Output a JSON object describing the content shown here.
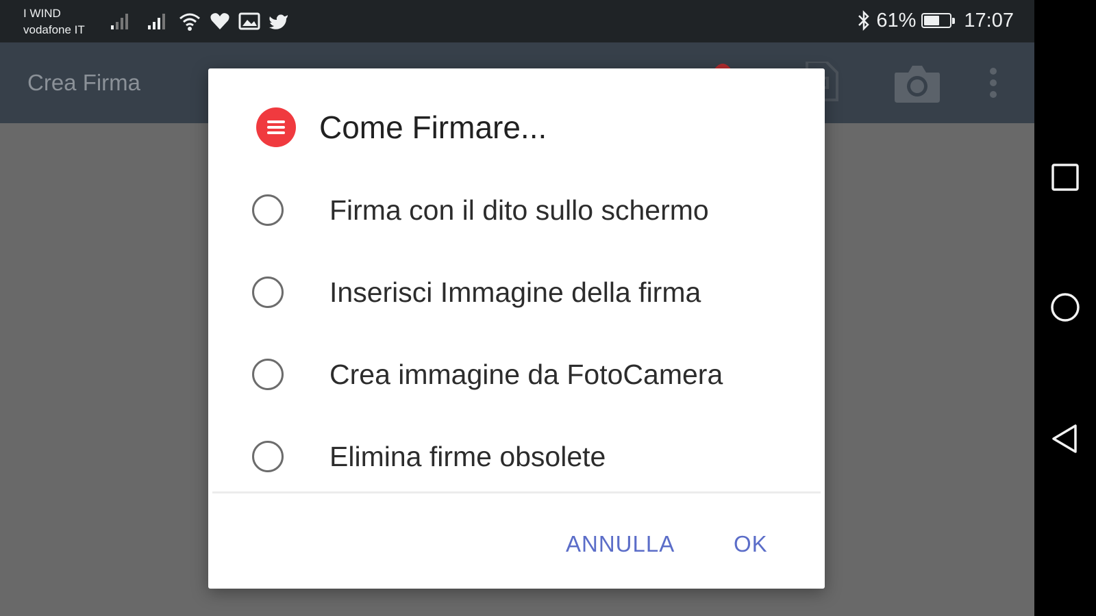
{
  "status_bar": {
    "carrier_line1": "I WIND",
    "carrier_line2": "vodafone IT",
    "battery_percent": "61%",
    "battery_level": 0.61,
    "time": "17:07",
    "icons": [
      "signal-weak-icon",
      "signal-icon",
      "wifi-icon",
      "heart-icon",
      "image-notification-icon",
      "twitter-icon",
      "bluetooth-icon",
      "battery-icon"
    ]
  },
  "app_bar": {
    "title": "Crea Firma",
    "actions": [
      "record-icon",
      "document-icon",
      "camera-icon",
      "more-vert-icon"
    ]
  },
  "dialog": {
    "icon": "menu-circle-icon",
    "icon_color": "#f03a3f",
    "title": "Come Firmare...",
    "options": [
      {
        "label": "Firma con il dito sullo schermo",
        "selected": false
      },
      {
        "label": "Inserisci Immagine della firma",
        "selected": false
      },
      {
        "label": "Crea immagine da FotoCamera",
        "selected": false
      },
      {
        "label": "Elimina firme obsolete",
        "selected": false
      }
    ],
    "cancel_label": "ANNULLA",
    "ok_label": "OK",
    "button_color": "#5b6dc8"
  },
  "nav_bar": {
    "buttons": [
      "recents-square-icon",
      "home-circle-icon",
      "back-triangle-icon"
    ]
  }
}
